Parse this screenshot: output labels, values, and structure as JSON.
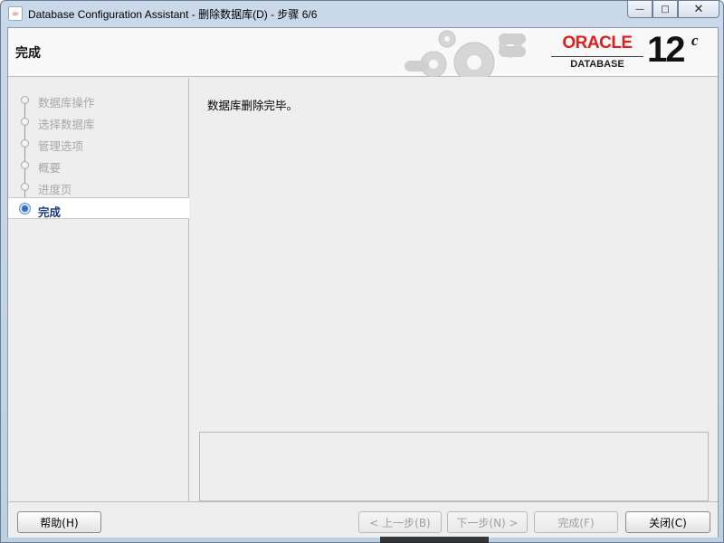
{
  "window": {
    "title": "Database Configuration Assistant - 删除数据库(D) - 步骤 6/6",
    "minimize_glyph": "—",
    "maximize_glyph": "□",
    "close_glyph": "✕"
  },
  "banner": {
    "title": "完成",
    "brand": "ORACLE",
    "product": "DATABASE",
    "version": "12",
    "version_suffix": "c"
  },
  "nav": {
    "items": [
      {
        "label": "数据库操作",
        "state": "done"
      },
      {
        "label": "选择数据库",
        "state": "done"
      },
      {
        "label": "管理选项",
        "state": "done"
      },
      {
        "label": "概要",
        "state": "done"
      },
      {
        "label": "进度页",
        "state": "done"
      },
      {
        "label": "完成",
        "state": "active"
      }
    ]
  },
  "content": {
    "message": "数据库删除完毕。"
  },
  "buttons": {
    "help": "帮助(H)",
    "back": "< 上一步(B)",
    "next": "下一步(N) >",
    "finish": "完成(F)",
    "close": "关闭(C)"
  },
  "colors": {
    "oracle_red": "#e0201b",
    "active_nav_text": "#1a3a78",
    "disabled_text": "#a8a8a8"
  }
}
